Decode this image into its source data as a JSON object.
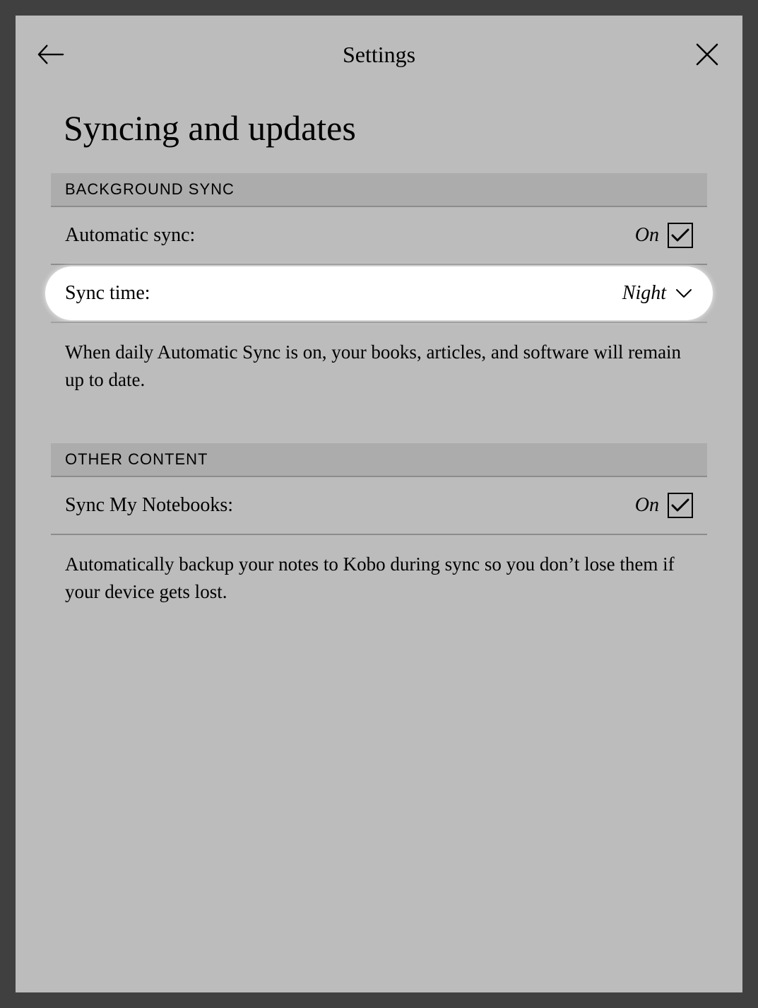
{
  "header": {
    "title": "Settings"
  },
  "page": {
    "title": "Syncing and updates"
  },
  "sections": {
    "background_sync": {
      "header": "BACKGROUND SYNC",
      "automatic_sync": {
        "label": "Automatic sync:",
        "value": "On"
      },
      "sync_time": {
        "label": "Sync time:",
        "value": "Night"
      },
      "description": "When daily Automatic Sync is on, your books, articles, and software will remain up to date."
    },
    "other_content": {
      "header": "OTHER CONTENT",
      "sync_notebooks": {
        "label": "Sync My Notebooks:",
        "value": "On"
      },
      "description": "Automatically backup your notes to Kobo during sync so you don’t lose them if your device gets lost."
    }
  }
}
